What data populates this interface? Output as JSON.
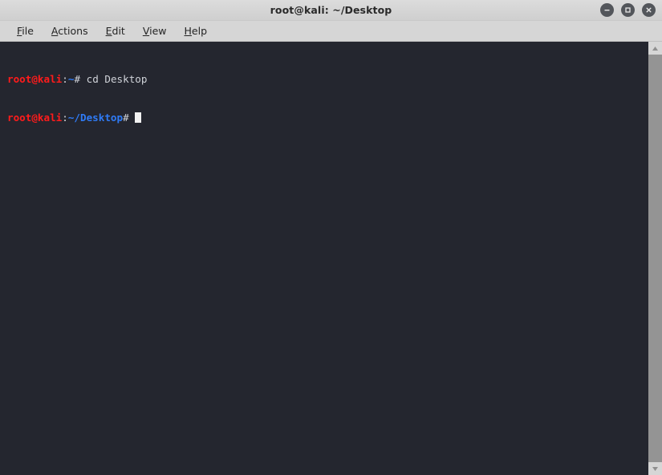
{
  "window": {
    "title": "root@kali: ~/Desktop",
    "controls": [
      {
        "name": "minimize",
        "glyph": "minus"
      },
      {
        "name": "maximize",
        "glyph": "square"
      },
      {
        "name": "close",
        "glyph": "cross"
      }
    ]
  },
  "menubar": {
    "items": [
      {
        "mnemonic": "F",
        "rest": "ile"
      },
      {
        "mnemonic": "A",
        "rest": "ctions"
      },
      {
        "mnemonic": "E",
        "rest": "dit"
      },
      {
        "mnemonic": "V",
        "rest": "iew"
      },
      {
        "mnemonic": "H",
        "rest": "elp"
      }
    ]
  },
  "terminal": {
    "lines": [
      {
        "user": "root@kali",
        "colon": ":",
        "path": "~",
        "hash": "#",
        "command": " cd Desktop",
        "cursor": false
      },
      {
        "user": "root@kali",
        "colon": ":",
        "path": "~/Desktop",
        "hash": "#",
        "command": " ",
        "cursor": true
      }
    ]
  },
  "scrollbar": {
    "up_arrow": "▲",
    "down_arrow": "▼"
  },
  "colors": {
    "terminal_bg": "#24262f",
    "prompt_user": "#ff1b1b",
    "prompt_path": "#2f7bf6",
    "text": "#d0d3d9",
    "chrome": "#d6d6d6"
  }
}
